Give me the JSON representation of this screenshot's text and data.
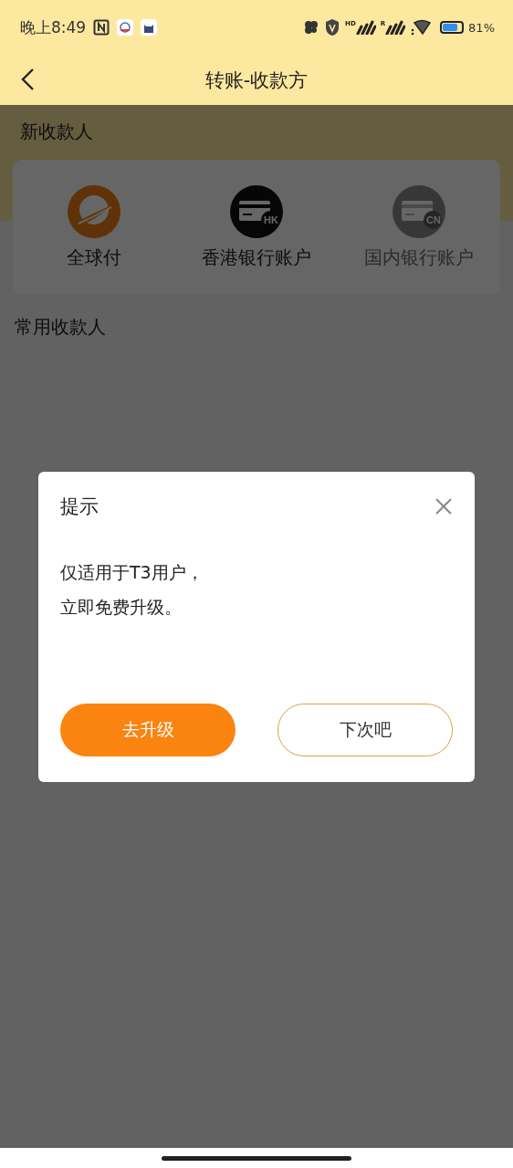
{
  "status_bar": {
    "time": "晚上8:49",
    "signals": [
      {
        "label": "HD"
      },
      {
        "label": "R"
      }
    ],
    "battery": {
      "reading": "81%"
    }
  },
  "header": {
    "title": "转账-收款方"
  },
  "new_payee": {
    "title": "新收款人",
    "options": [
      {
        "kind": "global",
        "label": "全球付",
        "disabled": false
      },
      {
        "kind": "hk",
        "label": "香港银行账户",
        "badge": "HK",
        "disabled": false
      },
      {
        "kind": "cn",
        "label": "国内银行账户",
        "badge": "CN",
        "disabled": true
      }
    ]
  },
  "frequent_payees": {
    "title": "常用收款人"
  },
  "dialog": {
    "title": "提示",
    "lines": [
      "仅适用于T3用户，",
      "立即免费升级。"
    ],
    "buttons": [
      {
        "label": "去升级",
        "kind": "primary"
      },
      {
        "label": "下次吧",
        "kind": "secondary"
      }
    ]
  }
}
